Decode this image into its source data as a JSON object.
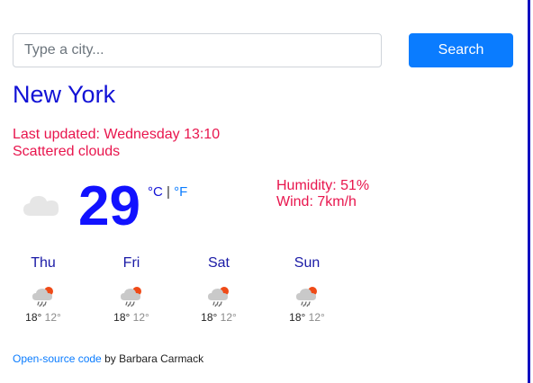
{
  "search": {
    "placeholder": "Type a city...",
    "value": "",
    "button_label": "Search"
  },
  "weather": {
    "city": "New York",
    "last_updated": "Last updated: Wednesday 13:10",
    "description": "Scattered clouds",
    "icon": "cloud-icon",
    "temperature": "29",
    "unit_celsius": "°C",
    "unit_separator": "|",
    "unit_fahrenheit": "°F",
    "humidity": "Humidity: 51%",
    "wind": "Wind: 7km/h"
  },
  "forecast": [
    {
      "day": "Thu",
      "max": "18°",
      "min": "12°",
      "icon": "rain-sun-icon"
    },
    {
      "day": "Fri",
      "max": "18°",
      "min": "12°",
      "icon": "rain-sun-icon"
    },
    {
      "day": "Sat",
      "max": "18°",
      "min": "12°",
      "icon": "rain-sun-icon"
    },
    {
      "day": "Sun",
      "max": "18°",
      "min": "12°",
      "icon": "rain-sun-icon"
    }
  ],
  "footer": {
    "link_text": "Open-source code",
    "suffix": " by Barbara Carmack"
  },
  "colors": {
    "accent": "#0a7cff",
    "city": "#1212d6",
    "highlight": "#e8154d",
    "temperature": "#1212ff"
  }
}
